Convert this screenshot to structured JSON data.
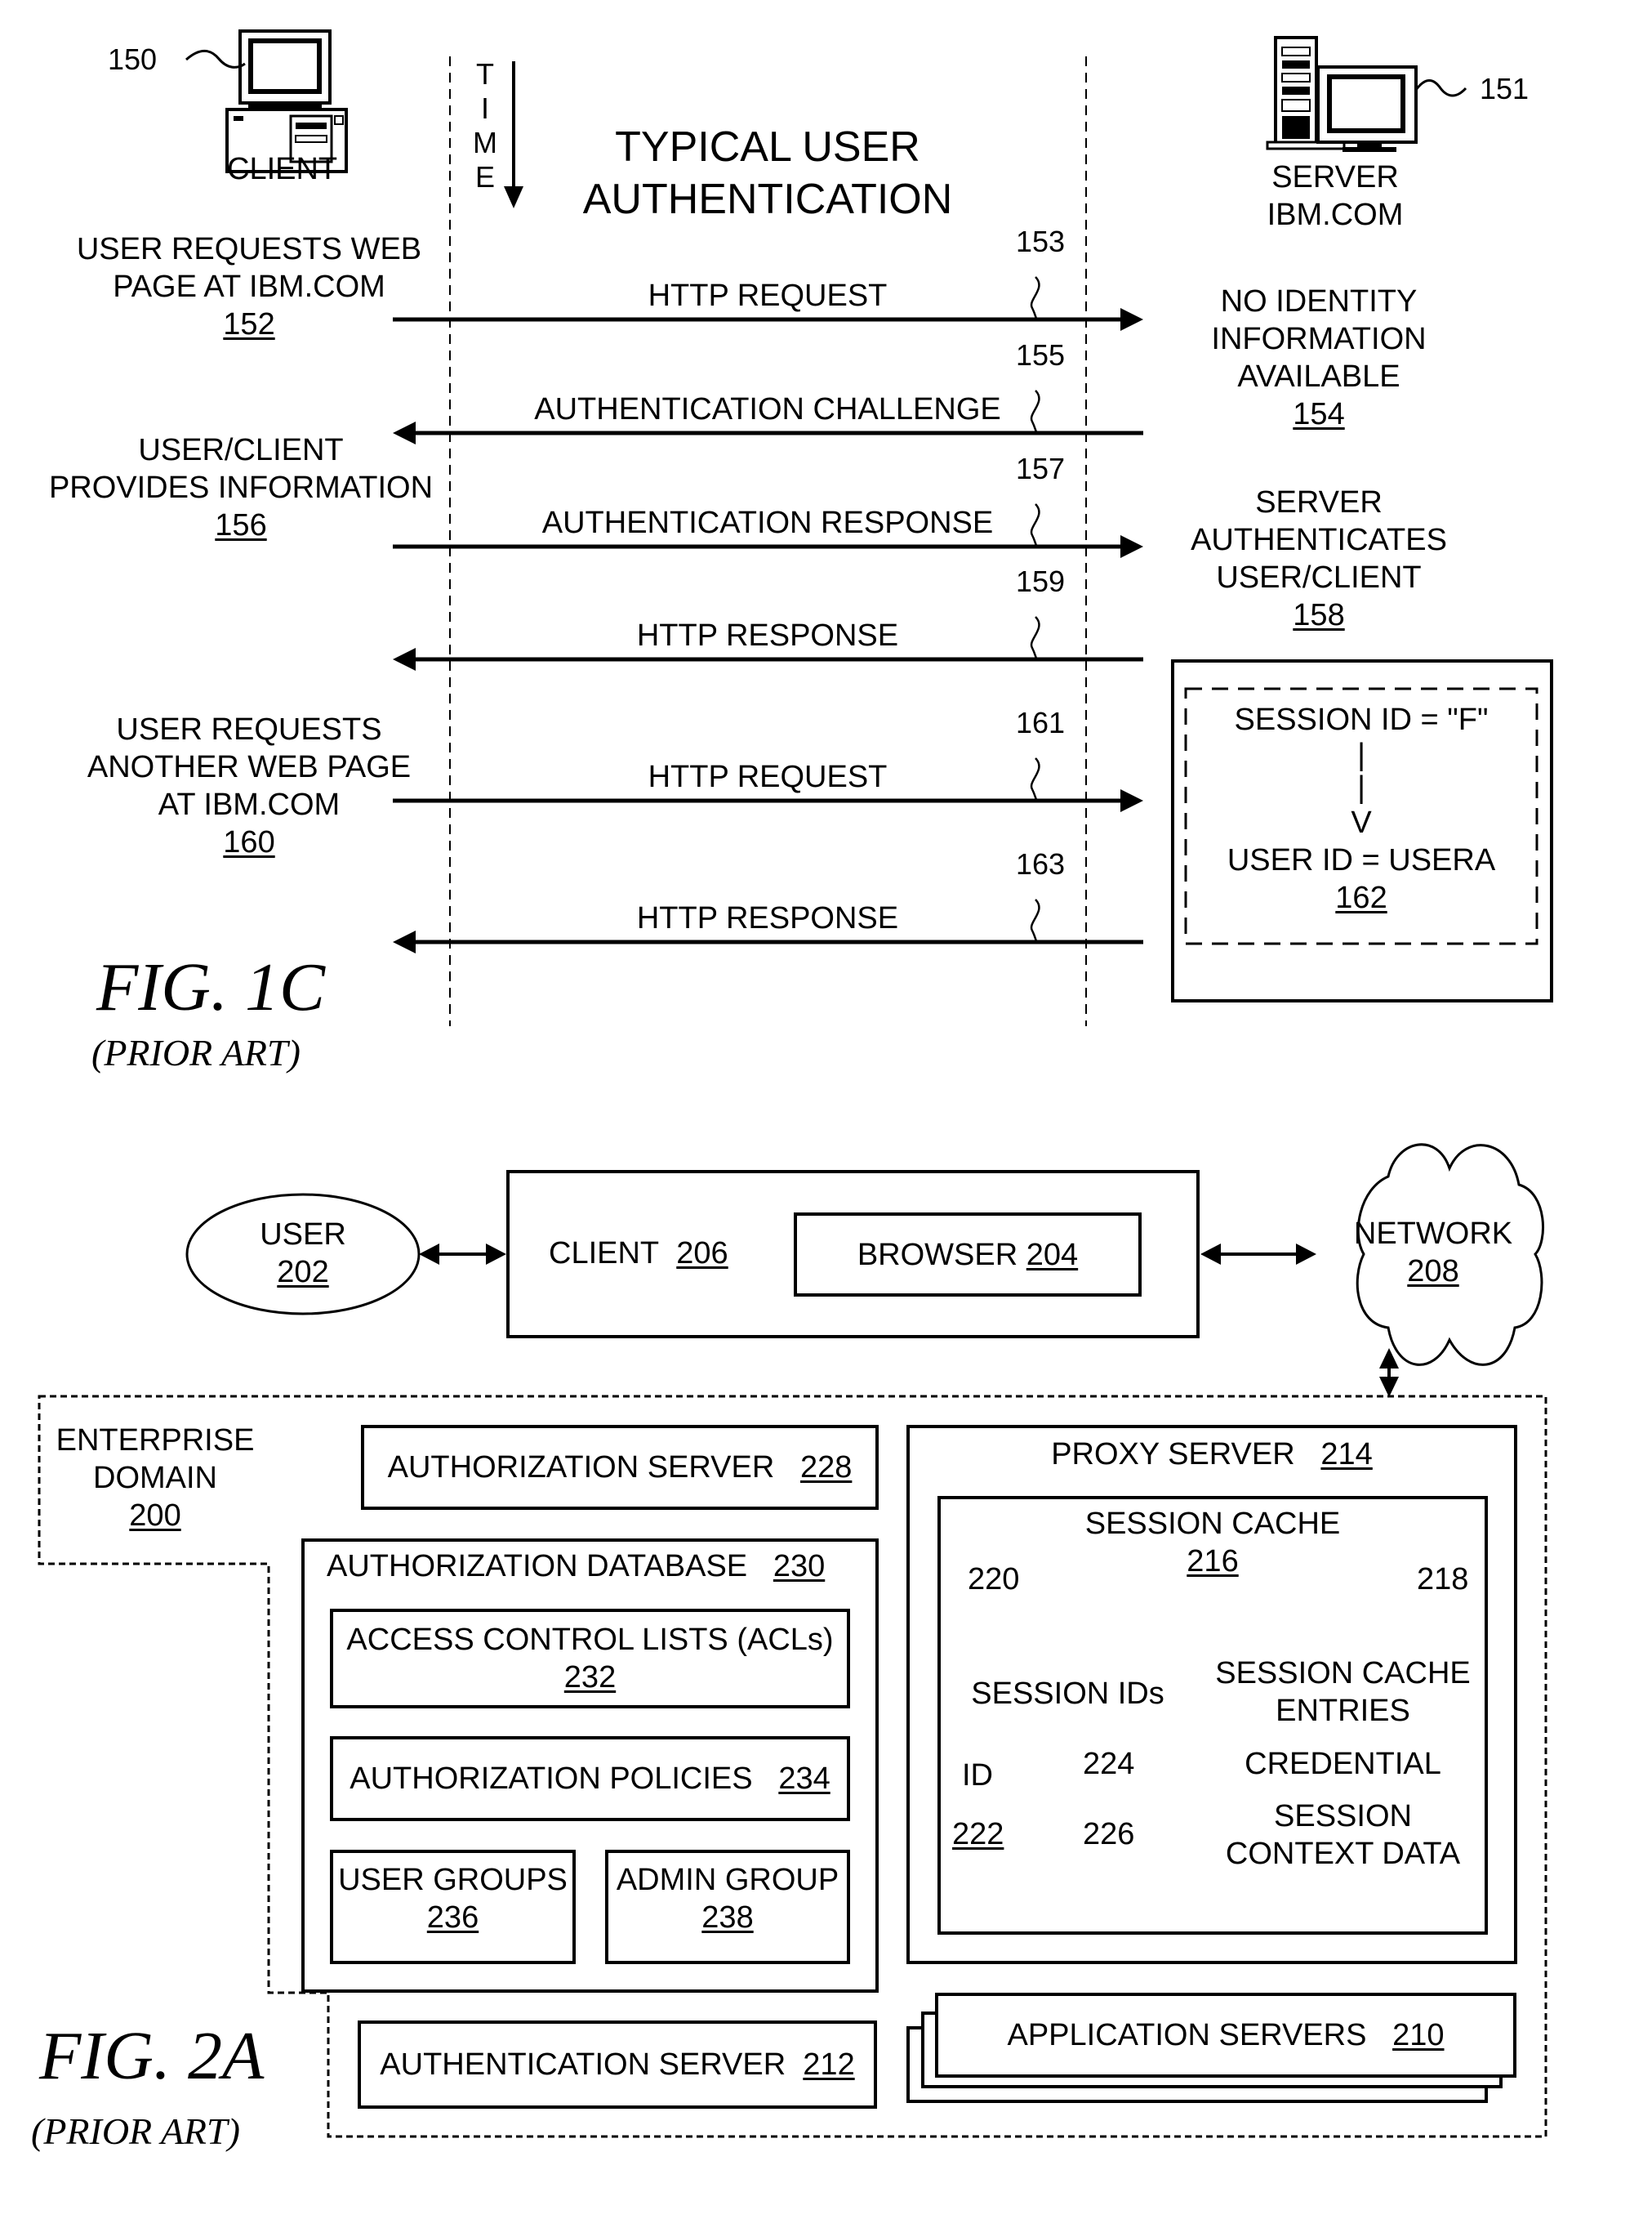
{
  "fig1c": {
    "title": [
      "TYPICAL USER",
      "AUTHENTICATION"
    ],
    "time_label": [
      "T",
      "I",
      "M",
      "E"
    ],
    "client": {
      "label": "CLIENT",
      "ref": "150"
    },
    "server": {
      "label": [
        "SERVER",
        "IBM.COM"
      ],
      "ref": "151"
    },
    "messages": [
      {
        "label": "HTTP REQUEST",
        "ref": "153",
        "direction": "to-server"
      },
      {
        "label": "AUTHENTICATION CHALLENGE",
        "ref": "155",
        "direction": "to-client"
      },
      {
        "label": "AUTHENTICATION RESPONSE",
        "ref": "157",
        "direction": "to-server"
      },
      {
        "label": "HTTP RESPONSE",
        "ref": "159",
        "direction": "to-client"
      },
      {
        "label": "HTTP REQUEST",
        "ref": "161",
        "direction": "to-server"
      },
      {
        "label": "HTTP RESPONSE",
        "ref": "163",
        "direction": "to-client"
      }
    ],
    "client_steps": [
      {
        "lines": [
          "USER REQUESTS WEB",
          "PAGE AT IBM.COM"
        ],
        "ref": "152"
      },
      {
        "lines": [
          "USER/CLIENT",
          "PROVIDES INFORMATION"
        ],
        "ref": "156"
      },
      {
        "lines": [
          "USER REQUESTS",
          "ANOTHER WEB PAGE",
          "AT IBM.COM"
        ],
        "ref": "160"
      }
    ],
    "server_steps": [
      {
        "lines": [
          "NO IDENTITY",
          "INFORMATION",
          "AVAILABLE"
        ],
        "ref": "154"
      },
      {
        "lines": [
          "SERVER",
          "AUTHENTICATES",
          "USER/CLIENT"
        ],
        "ref": "158"
      }
    ],
    "mapping": {
      "session": "SESSION ID = \"F\"",
      "pipe": "|",
      "arrow": "V",
      "user": "USER ID = USERA",
      "ref": "162"
    },
    "caption": {
      "title": "FIG. 1C",
      "subtitle": "(PRIOR ART)"
    }
  },
  "fig2a": {
    "user": {
      "label": "USER",
      "ref": "202"
    },
    "client": {
      "label": "CLIENT",
      "ref": "206"
    },
    "browser": {
      "label": "BROWSER",
      "ref": "204"
    },
    "network": {
      "label": "NETWORK",
      "ref": "208"
    },
    "enterprise": {
      "lines": [
        "ENTERPRISE",
        "DOMAIN"
      ],
      "ref": "200"
    },
    "authz_server": {
      "label": "AUTHORIZATION SERVER",
      "ref": "228"
    },
    "authz_db": {
      "label": "AUTHORIZATION DATABASE",
      "ref": "230"
    },
    "acl": {
      "label": "ACCESS CONTROL LISTS (ACLs)",
      "ref": "232"
    },
    "policies": {
      "label": "AUTHORIZATION POLICIES",
      "ref": "234"
    },
    "user_groups": {
      "label": "USER GROUPS",
      "ref": "236"
    },
    "admin_group": {
      "label": "ADMIN GROUP",
      "ref": "238"
    },
    "authn_server": {
      "label": "AUTHENTICATION SERVER",
      "ref": "212"
    },
    "proxy": {
      "label": "PROXY SERVER",
      "ref": "214"
    },
    "session_cache": {
      "label": "SESSION CACHE",
      "ref": "216",
      "left_ref": "220",
      "right_ref": "218"
    },
    "table": {
      "col1_header": "SESSION IDs",
      "col2_header": [
        "SESSION CACHE",
        "ENTRIES"
      ],
      "id_label": "ID",
      "id_ref": "222",
      "credential_ref": "224",
      "context_ref": "226",
      "credential": "CREDENTIAL",
      "context": [
        "SESSION",
        "CONTEXT DATA"
      ]
    },
    "app_servers": {
      "label": "APPLICATION SERVERS",
      "ref": "210"
    },
    "caption": {
      "title": "FIG. 2A",
      "subtitle": "(PRIOR ART)"
    }
  }
}
